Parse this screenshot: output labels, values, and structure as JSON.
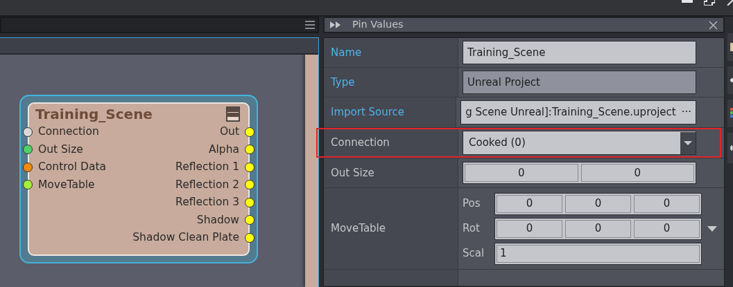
{
  "node_editor": {
    "node": {
      "title": "Training_Scene",
      "inputs": [
        {
          "label": "Connection",
          "color": "#d9d9d9"
        },
        {
          "label": "Out Size",
          "color": "#4fd06a"
        },
        {
          "label": "Control Data",
          "color": "#f28a10"
        },
        {
          "label": "MoveTable",
          "color": "#a6f03c"
        }
      ],
      "outputs": [
        {
          "label": "Out",
          "color": "#ffff10"
        },
        {
          "label": "Alpha",
          "color": "#ffff10"
        },
        {
          "label": "Reflection 1",
          "color": "#ffff10"
        },
        {
          "label": "Reflection 2",
          "color": "#ffff10"
        },
        {
          "label": "Reflection 3",
          "color": "#ffff10"
        },
        {
          "label": "Shadow",
          "color": "#ffff10"
        },
        {
          "label": "Shadow Clean Plate",
          "color": "#ffff10"
        }
      ]
    }
  },
  "pin_values": {
    "title": "Pin Values",
    "rows": [
      {
        "kind": "text",
        "label": "Name",
        "accent": true,
        "highlighted": false,
        "value": "Training_Scene"
      },
      {
        "kind": "readonly",
        "label": "Type",
        "accent": true,
        "highlighted": false,
        "value": "Unreal Project"
      },
      {
        "kind": "path",
        "label": "Import Source",
        "accent": true,
        "highlighted": false,
        "value": "g Scene Unreal]:Training_Scene.uproject",
        "button": "···"
      },
      {
        "kind": "dropdown",
        "label": "Connection",
        "accent": false,
        "highlighted": true,
        "value": "Cooked (0)"
      },
      {
        "kind": "pair",
        "label": "Out Size",
        "accent": false,
        "highlighted": false,
        "values": [
          "0",
          "0"
        ]
      },
      {
        "kind": "transform",
        "label": "MoveTable",
        "accent": false,
        "highlighted": false,
        "fields": [
          {
            "label": "Pos",
            "values": [
              "0",
              "0",
              "0"
            ]
          },
          {
            "label": "Rot",
            "values": [
              "0",
              "0",
              "0"
            ]
          },
          {
            "label": "Scal",
            "values": [
              "1"
            ]
          }
        ]
      }
    ]
  }
}
